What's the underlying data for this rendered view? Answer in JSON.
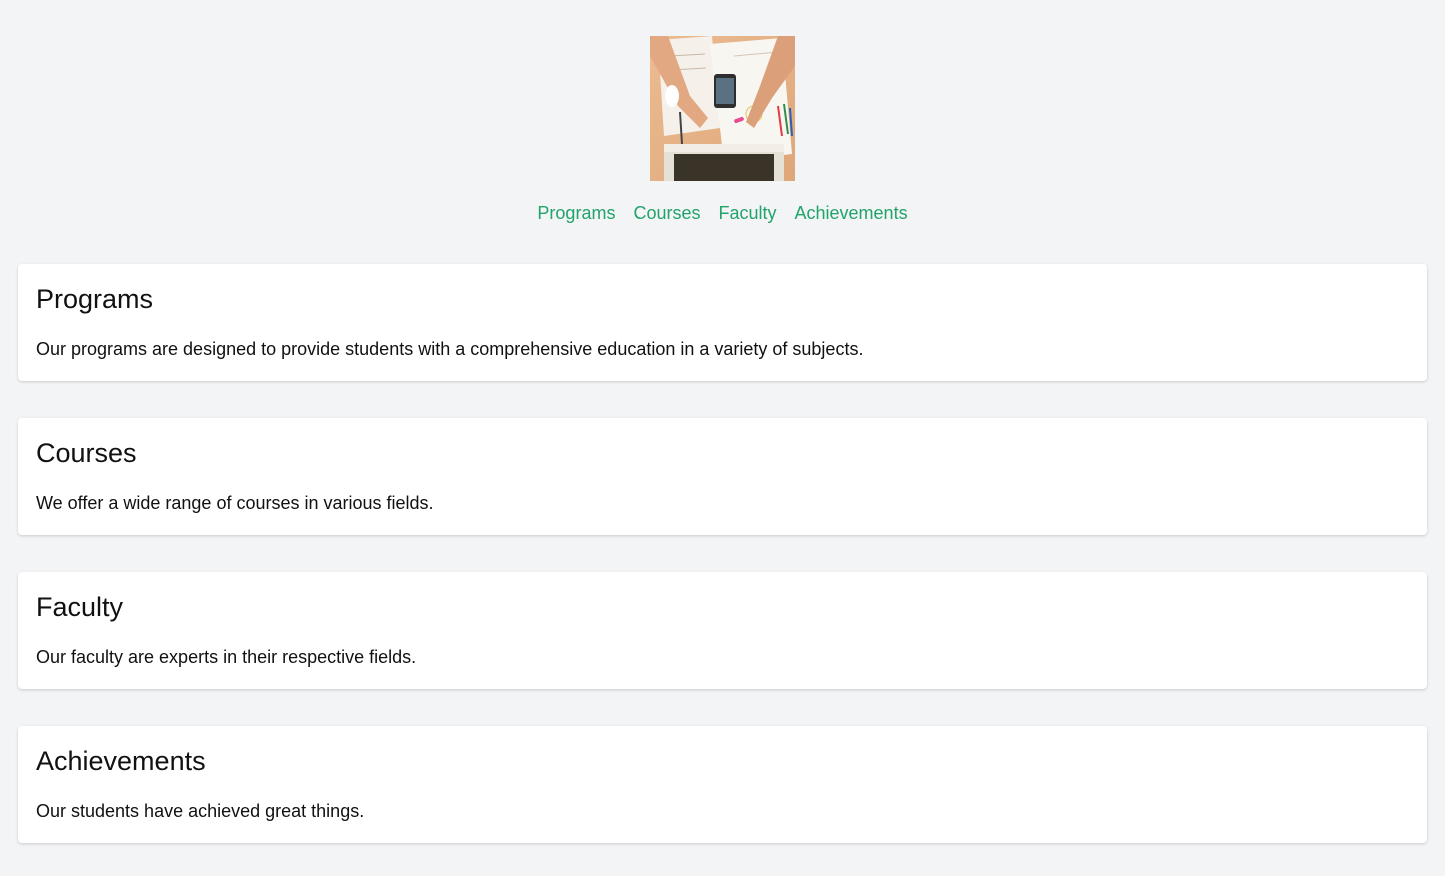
{
  "header": {
    "logo_image": "desk-workspace-photo"
  },
  "nav": {
    "items": [
      {
        "label": "Programs"
      },
      {
        "label": "Courses"
      },
      {
        "label": "Faculty"
      },
      {
        "label": "Achievements"
      }
    ]
  },
  "sections": [
    {
      "title": "Programs",
      "text": "Our programs are designed to provide students with a comprehensive education in a variety of subjects."
    },
    {
      "title": "Courses",
      "text": "We offer a wide range of courses in various fields."
    },
    {
      "title": "Faculty",
      "text": "Our faculty are experts in their respective fields."
    },
    {
      "title": "Achievements",
      "text": "Our students have achieved great things."
    }
  ],
  "colors": {
    "background": "#f3f4f6",
    "link": "#22a36a",
    "card": "#ffffff",
    "text": "#111111"
  }
}
